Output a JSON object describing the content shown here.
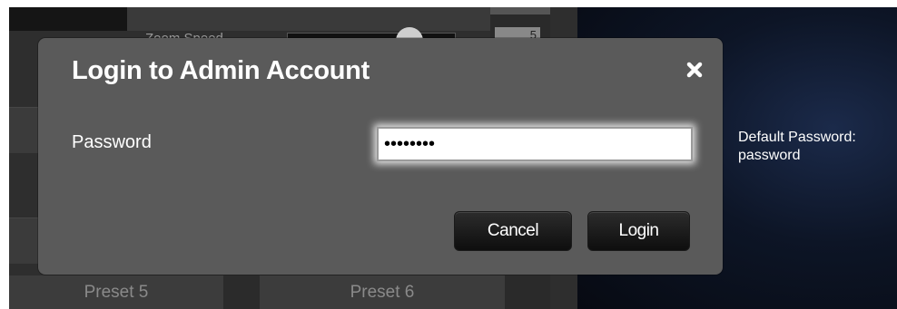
{
  "background_app": {
    "zoom_label": "Zoom Speed",
    "zoom_value": "5",
    "presets": [
      "Preset 5",
      "Preset 6"
    ]
  },
  "dialog": {
    "title": "Login to Admin Account",
    "close_icon": "close-x",
    "password_label": "Password",
    "password_value": "password",
    "cancel_label": "Cancel",
    "login_label": "Login"
  },
  "hint": {
    "line1": "Default Password:",
    "line2": "password"
  },
  "colors": {
    "modal_bg": "#5a5a5a",
    "button_bg": "#111111",
    "page_bg": "#0f0f14"
  }
}
